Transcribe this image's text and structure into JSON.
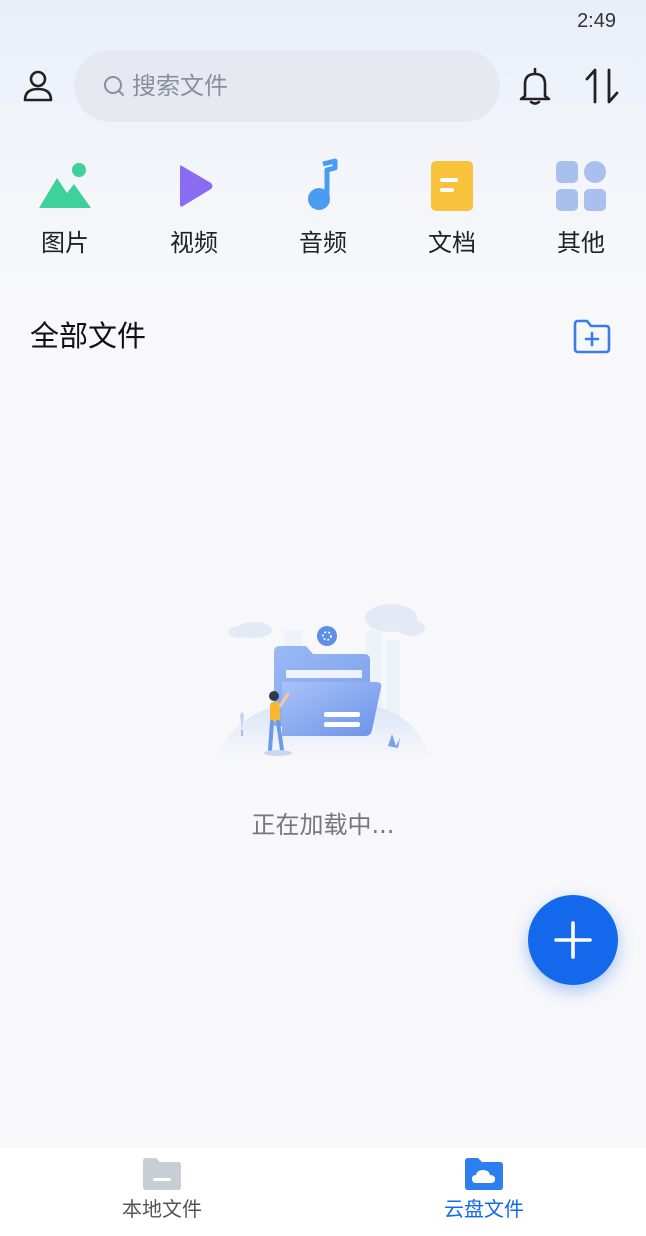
{
  "status_bar": {
    "time": "2:49"
  },
  "header": {
    "search_placeholder": "搜索文件",
    "icons": [
      "user-icon",
      "search-icon",
      "bell-icon",
      "transfer-icon"
    ]
  },
  "categories": [
    {
      "label": "图片",
      "icon": "image-icon",
      "color": "#3fd19b"
    },
    {
      "label": "视频",
      "icon": "video-icon",
      "color": "#8a6cf2"
    },
    {
      "label": "音频",
      "icon": "audio-icon",
      "color": "#4a9cf2"
    },
    {
      "label": "文档",
      "icon": "document-icon",
      "color": "#f9c23c"
    },
    {
      "label": "其他",
      "icon": "other-icon",
      "color": "#a9c0ee"
    }
  ],
  "main": {
    "section_title": "全部文件",
    "loading_text": "正在加载中..."
  },
  "bottom_nav": {
    "items": [
      {
        "label": "本地文件",
        "icon": "local-folder-icon",
        "active": false
      },
      {
        "label": "云盘文件",
        "icon": "cloud-folder-icon",
        "active": true
      }
    ]
  },
  "colors": {
    "accent": "#1468ec",
    "background": "#f8f8fa"
  }
}
